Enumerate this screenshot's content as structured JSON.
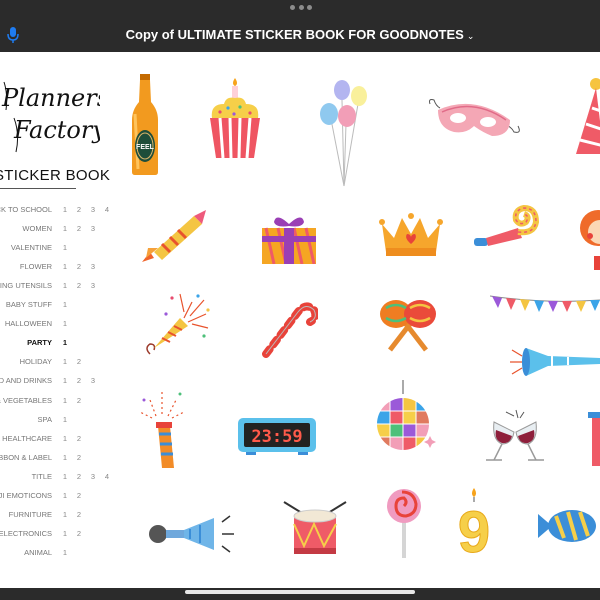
{
  "window": {
    "title": "Copy of ULTIMATE STICKER BOOK FOR GOODNOTES",
    "chevron": "⌄"
  },
  "sidebar": {
    "brand_line1": "Planners",
    "brand_line2": "Factory",
    "heading": "STICKER BOOK",
    "items": [
      {
        "label": "BACK TO SCHOOL",
        "pages": [
          "1",
          "2",
          "3",
          "4"
        ]
      },
      {
        "label": "WOMEN",
        "pages": [
          "1",
          "2",
          "3"
        ]
      },
      {
        "label": "VALENTINE",
        "pages": [
          "1"
        ]
      },
      {
        "label": "FLOWER",
        "pages": [
          "1",
          "2",
          "3"
        ]
      },
      {
        "label": "COOKING UTENSILS",
        "pages": [
          "1",
          "2",
          "3"
        ]
      },
      {
        "label": "BABY STUFF",
        "pages": [
          "1"
        ]
      },
      {
        "label": "HALLOWEEN",
        "pages": [
          "1"
        ]
      },
      {
        "label": "PARTY",
        "pages": [
          "1"
        ],
        "active": true
      },
      {
        "label": "HOLIDAY",
        "pages": [
          "1",
          "2"
        ]
      },
      {
        "label": "FOOD AND DRINKS",
        "pages": [
          "1",
          "2",
          "3"
        ]
      },
      {
        "label": "FRUITS & VEGETABLES",
        "pages": [
          "1",
          "2"
        ]
      },
      {
        "label": "SPA",
        "pages": [
          "1"
        ]
      },
      {
        "label": "MENTAL HEALTHCARE",
        "pages": [
          "1",
          "2"
        ]
      },
      {
        "label": "RIBBON & LABEL",
        "pages": [
          "1",
          "2"
        ]
      },
      {
        "label": "TITLE",
        "pages": [
          "1",
          "2",
          "3",
          "4"
        ]
      },
      {
        "label": "EMOJI EMOTICONS",
        "pages": [
          "1",
          "2"
        ]
      },
      {
        "label": "FURNITURE",
        "pages": [
          "1",
          "2"
        ]
      },
      {
        "label": "ELECTRONICS",
        "pages": [
          "1",
          "2"
        ]
      },
      {
        "label": "ANIMAL",
        "pages": [
          "1"
        ]
      }
    ]
  },
  "stickers": {
    "bottle_label": "FEEL",
    "clock_display": "23:59",
    "candle_number": "9"
  },
  "icons": {
    "mic": "microphone-icon",
    "more": "more-dots-icon"
  },
  "colors": {
    "chrome": "#2b2b2b",
    "page": "#ffffff",
    "mic_blue": "#1e7cf2"
  }
}
